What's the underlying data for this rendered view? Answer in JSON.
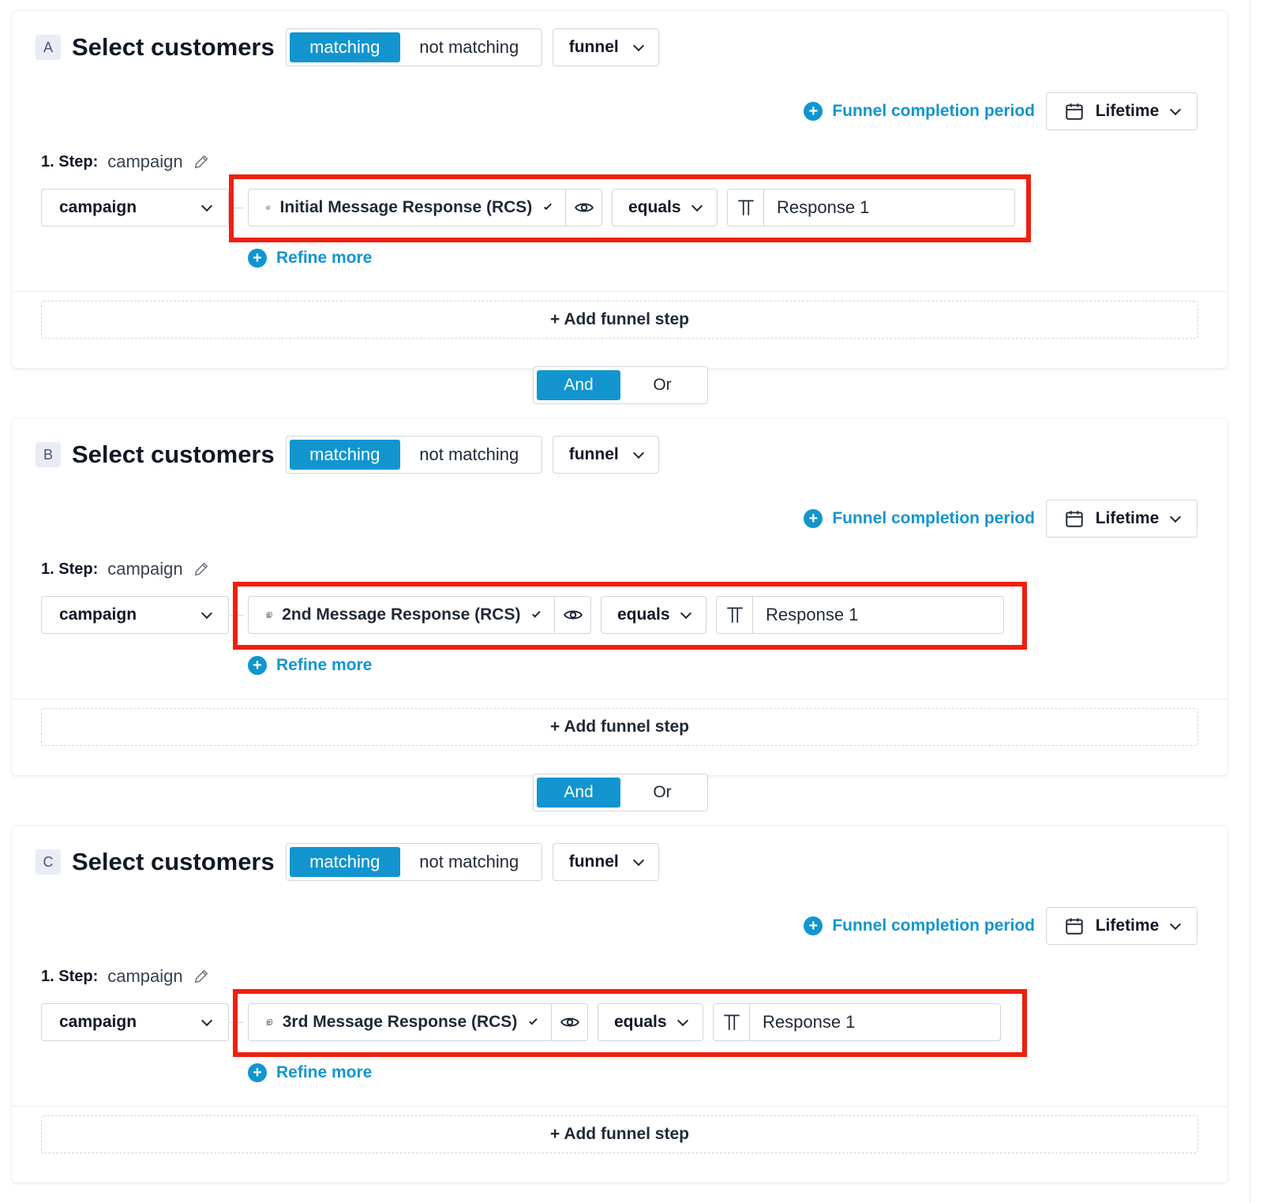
{
  "colors": {
    "accent": "#1295cf",
    "highlight": "#ee2010"
  },
  "icons": {
    "period": "plus-circle-icon",
    "calendar": "calendar-icon",
    "edit": "pencil-icon",
    "attribute": "play-square-icon",
    "visibility": "eye-icon",
    "value_type": "text-type-icon",
    "refine": "plus-circle-icon",
    "dropdown": "chevron-down-icon"
  },
  "selectors": [
    {
      "letter": "A",
      "title": "Select customers",
      "matching": "matching",
      "not_matching": "not matching",
      "active": "matching",
      "type": "funnel",
      "period_link": "Funnel completion period",
      "period_value": "Lifetime",
      "step_number": "1. Step:",
      "step_name": "campaign",
      "step_type": "campaign",
      "attribute": "Initial Message Response (RCS)",
      "operator": "equals",
      "value": "Response 1",
      "refine": "Refine more",
      "add_step": "+ Add funnel step"
    },
    {
      "letter": "B",
      "title": "Select customers",
      "matching": "matching",
      "not_matching": "not matching",
      "active": "matching",
      "type": "funnel",
      "period_link": "Funnel completion period",
      "period_value": "Lifetime",
      "step_number": "1. Step:",
      "step_name": "campaign",
      "step_type": "campaign",
      "attribute": "2nd Message Response (RCS)",
      "operator": "equals",
      "value": "Response 1",
      "refine": "Refine more",
      "add_step": "+ Add funnel step"
    },
    {
      "letter": "C",
      "title": "Select customers",
      "matching": "matching",
      "not_matching": "not matching",
      "active": "matching",
      "type": "funnel",
      "period_link": "Funnel completion period",
      "period_value": "Lifetime",
      "step_number": "1. Step:",
      "step_name": "campaign",
      "step_type": "campaign",
      "attribute": "3rd Message Response (RCS)",
      "operator": "equals",
      "value": "Response 1",
      "refine": "Refine more",
      "add_step": "+ Add funnel step"
    }
  ],
  "combinators": [
    {
      "and": "And",
      "or": "Or",
      "active": "And"
    },
    {
      "and": "And",
      "or": "Or",
      "active": "And"
    }
  ]
}
